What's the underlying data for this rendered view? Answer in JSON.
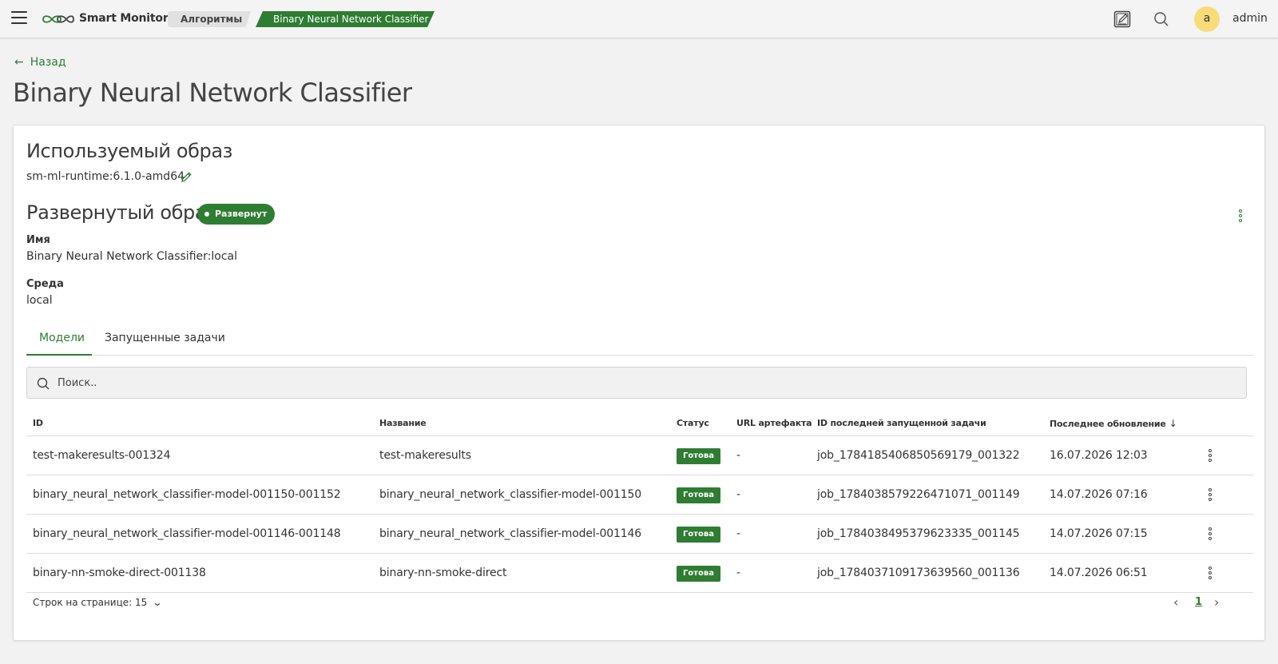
{
  "topbar": {
    "app_title": "Smart Monitor",
    "breadcrumbs": [
      "Алгоритмы",
      "Binary Neural Network Classifier"
    ],
    "avatar_letter": "a",
    "user_name": "admin",
    "icons": [
      "menu-icon",
      "logo-icon",
      "notes-icon",
      "search-icon"
    ]
  },
  "header": {
    "back_label": "Назад",
    "page_title": "Binary Neural Network Classifier"
  },
  "image_section": {
    "title": "Используемый образ",
    "value": "sm-ml-runtime:6.1.0-amd64"
  },
  "deployed_section": {
    "title": "Развернутый образ",
    "badge": "Развернут",
    "name_label": "Имя",
    "name_value": "Binary Neural Network Classifier:local",
    "env_label": "Среда",
    "env_value": "local"
  },
  "tabs": [
    {
      "label": "Модели",
      "active": true
    },
    {
      "label": "Запущенные задачи",
      "active": false
    }
  ],
  "search": {
    "placeholder": "Поиск.."
  },
  "table": {
    "headers": {
      "id": "ID",
      "name": "Название",
      "status": "Статус",
      "url": "URL артефакта",
      "last_job": "ID последней запущенной задачи",
      "updated": "Последнее обновление"
    },
    "rows": [
      {
        "id": "test-makeresults-001324",
        "name": "test-makeresults",
        "status": "Готова",
        "url": "-",
        "last_job": "job_1784185406850569179_001322",
        "updated": "16.07.2026 12:03"
      },
      {
        "id": "binary_neural_network_classifier-model-001150-001152",
        "name": "binary_neural_network_classifier-model-001150",
        "status": "Готова",
        "url": "-",
        "last_job": "job_1784038579226471071_001149",
        "updated": "14.07.2026 07:16"
      },
      {
        "id": "binary_neural_network_classifier-model-001146-001148",
        "name": "binary_neural_network_classifier-model-001146",
        "status": "Готова",
        "url": "-",
        "last_job": "job_1784038495379623335_001145",
        "updated": "14.07.2026 07:15"
      },
      {
        "id": "binary-nn-smoke-direct-001138",
        "name": "binary-nn-smoke-direct",
        "status": "Готова",
        "url": "-",
        "last_job": "job_1784037109173639560_001136",
        "updated": "14.07.2026 06:51"
      }
    ]
  },
  "pagination": {
    "rows_per_page_label": "Строк на странице: 15",
    "current_page": "1"
  },
  "colors": {
    "accent": "#2e7d32",
    "avatar": "#f8dc7a",
    "background": "#f2f2f2"
  }
}
